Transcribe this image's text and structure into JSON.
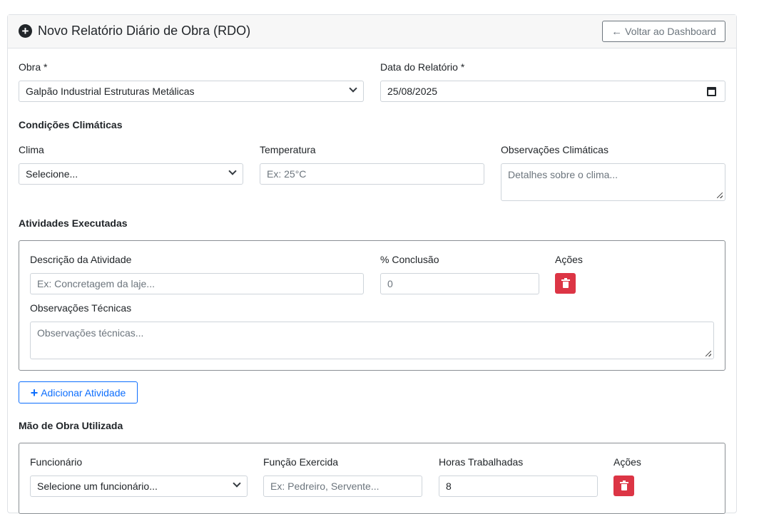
{
  "header": {
    "title": "Novo Relatório Diário de Obra (RDO)",
    "back_button": "Voltar ao Dashboard"
  },
  "obra": {
    "label": "Obra *",
    "value": "Galpão Industrial Estruturas Metálicas"
  },
  "data_relatorio": {
    "label": "Data do Relatório *",
    "value": "25/08/2025"
  },
  "climaticas": {
    "section_title": "Condições Climáticas",
    "clima_label": "Clima",
    "clima_value": "Selecione...",
    "temperatura_label": "Temperatura",
    "temperatura_placeholder": "Ex: 25°C",
    "obs_label": "Observações Climáticas",
    "obs_placeholder": "Detalhes sobre o clima..."
  },
  "atividades": {
    "section_title": "Atividades Executadas",
    "descricao_label": "Descrição da Atividade",
    "descricao_placeholder": "Ex: Concretagem da laje...",
    "conclusao_label": "% Conclusão",
    "conclusao_value": "0",
    "acoes_label": "Ações",
    "obs_label": "Observações Técnicas",
    "obs_placeholder": "Observações técnicas...",
    "add_button": "Adicionar Atividade"
  },
  "mao_de_obra": {
    "section_title": "Mão de Obra Utilizada",
    "funcionario_label": "Funcionário",
    "funcionario_value": "Selecione um funcionário...",
    "funcao_label": "Função Exercida",
    "funcao_placeholder": "Ex: Pedreiro, Servente...",
    "horas_label": "Horas Trabalhadas",
    "horas_value": "8",
    "acoes_label": "Ações"
  },
  "colors": {
    "primary": "#0d6efd",
    "danger": "#dc3545",
    "secondary": "#6c757d"
  }
}
